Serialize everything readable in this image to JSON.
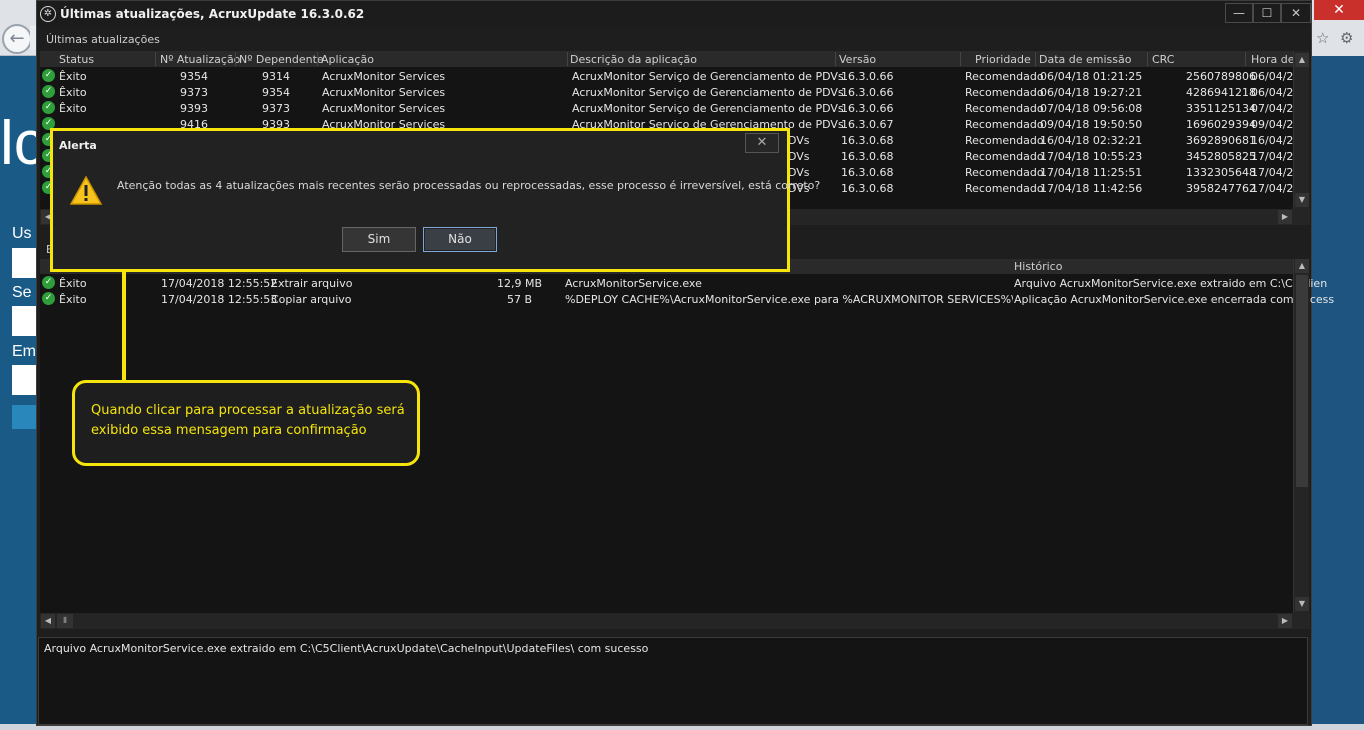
{
  "window": {
    "title": "Últimas atualizações, AcruxUpdate 16.3.0.62",
    "section_label": "Últimas atualizações",
    "btn_minimize": "—",
    "btn_maximize": "☐",
    "btn_close": "✕"
  },
  "updates_table": {
    "headers": [
      "Status",
      "Nº Atualização",
      "Nº Dependente",
      "Aplicação",
      "Descrição da aplicação",
      "Versão",
      "Prioridade",
      "Data de emissão",
      "CRC",
      "Hora de"
    ],
    "rows": [
      {
        "status": "Êxito",
        "num": "9354",
        "dep": "9314",
        "app": "AcruxMonitor Services",
        "desc": "AcruxMonitor Serviço de Gerenciamento de PDVs",
        "ver": "16.3.0.66",
        "prio": "Recomendado",
        "date": "06/04/18 01:21:25",
        "crc": "2560789806",
        "hora": "06/04/2"
      },
      {
        "status": "Êxito",
        "num": "9373",
        "dep": "9354",
        "app": "AcruxMonitor Services",
        "desc": "AcruxMonitor Serviço de Gerenciamento de PDVs",
        "ver": "16.3.0.66",
        "prio": "Recomendado",
        "date": "06/04/18 19:27:21",
        "crc": "4286941218",
        "hora": "06/04/2"
      },
      {
        "status": "Êxito",
        "num": "9393",
        "dep": "9373",
        "app": "AcruxMonitor Services",
        "desc": "AcruxMonitor Serviço de Gerenciamento de PDVs",
        "ver": "16.3.0.66",
        "prio": "Recomendado",
        "date": "07/04/18 09:56:08",
        "crc": "3351125134",
        "hora": "07/04/2"
      },
      {
        "status": "",
        "num": "9416",
        "dep": "9393",
        "app": "AcruxMonitor Services",
        "desc": "AcruxMonitor Serviço de Gerenciamento de PDVs",
        "ver": "16.3.0.67",
        "prio": "Recomendado",
        "date": "09/04/18 19:50:50",
        "crc": "1696029394",
        "hora": "09/04/2"
      },
      {
        "status": "",
        "num": "",
        "dep": "",
        "app": "",
        "desc": "DVs",
        "ver": "16.3.0.68",
        "prio": "Recomendado",
        "date": "16/04/18 02:32:21",
        "crc": "3692890681",
        "hora": "16/04/2"
      },
      {
        "status": "",
        "num": "",
        "dep": "",
        "app": "",
        "desc": "DVs",
        "ver": "16.3.0.68",
        "prio": "Recomendado",
        "date": "17/04/18 10:55:23",
        "crc": "3452805825",
        "hora": "17/04/2"
      },
      {
        "status": "",
        "num": "",
        "dep": "",
        "app": "",
        "desc": "DVs",
        "ver": "16.3.0.68",
        "prio": "Recomendado",
        "date": "17/04/18 11:25:51",
        "crc": "1332305648",
        "hora": "17/04/2"
      },
      {
        "status": "",
        "num": "",
        "dep": "",
        "app": "",
        "desc": "DVs",
        "ver": "16.3.0.68",
        "prio": "Recomendado",
        "date": "17/04/18 11:42:56",
        "crc": "3958247762",
        "hora": "17/04/2"
      }
    ]
  },
  "history_table": {
    "headers": [
      "E",
      "Histórico"
    ],
    "rows": [
      {
        "status": "Êxito",
        "time": "17/04/2018 12:55:52",
        "action": "Extrair arquivo",
        "size": "12,9 MB",
        "file": "AcruxMonitorService.exe",
        "hist": "Arquivo AcruxMonitorService.exe extraido em C:\\C5Clien"
      },
      {
        "status": "Êxito",
        "time": "17/04/2018 12:55:53",
        "action": "Copiar arquivo",
        "size": "57 B",
        "file": "%DEPLOY CACHE%\\AcruxMonitorService.exe para %ACRUXMONITOR SERVICES%\\AcruxMo",
        "hist": "Aplicação AcruxMonitorService.exe encerrada com sucess"
      }
    ]
  },
  "log_text": "Arquivo AcruxMonitorService.exe extraido em C:\\C5Client\\AcruxUpdate\\CacheInput\\UpdateFiles\\ com sucesso",
  "dialog": {
    "title": "Alerta",
    "message": "Atenção todas as 4 atualizações mais recentes serão processadas ou reprocessadas, esse processo é irreversível, está correto?",
    "yes_label": "Sim",
    "no_label": "Não"
  },
  "callout": {
    "text": "Quando clicar para processar a atualização será exibido essa mensagem para confirmação"
  },
  "background": {
    "big_letter": "lc",
    "label_1": "Us",
    "label_2": "Se",
    "label_3": "Em",
    "back_arrow": "←",
    "star_icon": "☆",
    "gear_icon": "⚙",
    "close_glyph": "✕"
  },
  "colors": {
    "highlight": "#f5e50a",
    "success": "#2e9e3a",
    "window_bg": "#1e1e1e"
  }
}
